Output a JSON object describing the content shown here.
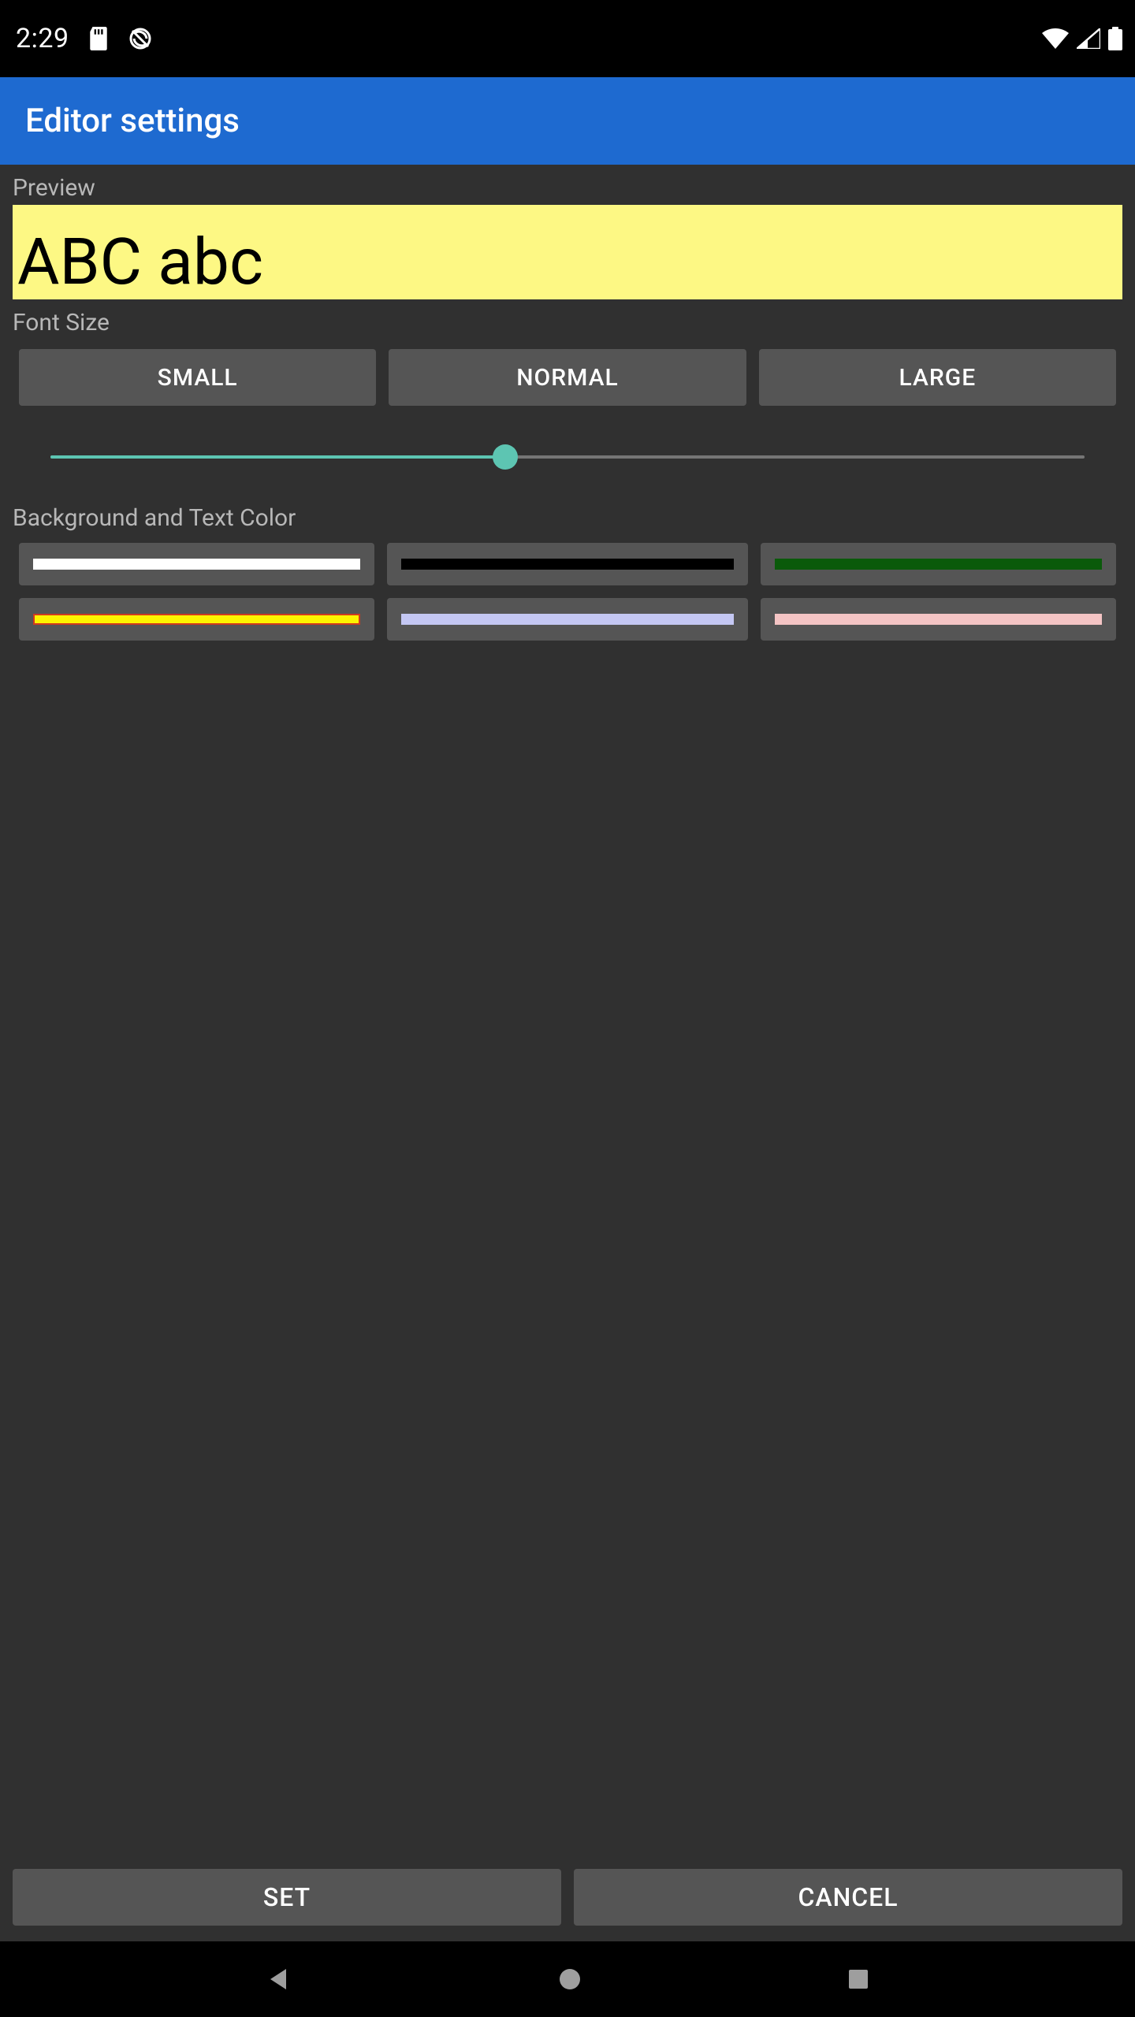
{
  "status": {
    "time": "2:29",
    "icons_left": [
      "sd-card-icon",
      "no-sync-icon"
    ],
    "icons_right": [
      "wifi-icon",
      "signal-icon",
      "battery-icon"
    ]
  },
  "app_bar": {
    "title": "Editor settings"
  },
  "preview": {
    "label": "Preview",
    "sample_text": "ABC abc"
  },
  "font_size": {
    "label": "Font Size",
    "buttons": {
      "small": "SMALL",
      "normal": "NORMAL",
      "large": "LARGE"
    },
    "slider_value_pct": 44
  },
  "colors": {
    "label": "Background and Text Color",
    "swatches": [
      {
        "name": "white",
        "fill": "#ffffff",
        "border": null,
        "selected": false
      },
      {
        "name": "black",
        "fill": "#000000",
        "border": null,
        "selected": false
      },
      {
        "name": "green",
        "fill": "#0a5a0a",
        "border": null,
        "selected": false
      },
      {
        "name": "yellow",
        "fill": "#fdf400",
        "border": "#d03a1e",
        "selected": true
      },
      {
        "name": "lilac",
        "fill": "#c4c7f3",
        "border": null,
        "selected": false
      },
      {
        "name": "pink",
        "fill": "#f4c4c4",
        "border": null,
        "selected": false
      }
    ]
  },
  "footer": {
    "set": "SET",
    "cancel": "CANCEL"
  }
}
